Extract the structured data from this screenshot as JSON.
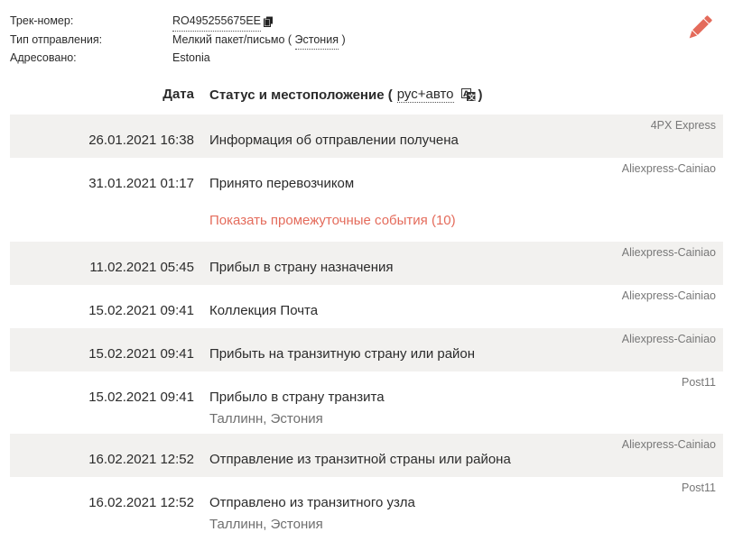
{
  "info": {
    "track_label": "Трек-номер:",
    "track_value": "RO495255675EE",
    "type_label": "Тип отправления:",
    "type_value_prefix": "Мелкий пакет/письмо ( ",
    "type_country": "Эстония",
    "type_value_suffix": " )",
    "address_label": "Адресовано:",
    "address_value": "Estonia"
  },
  "icons": {
    "copy": "copy-icon",
    "edit": "pencil-icon",
    "translate": "translate-icon"
  },
  "colors": {
    "accent": "#e46b5b",
    "row_shade": "#f2f1ef"
  },
  "table": {
    "date_header": "Дата",
    "status_header_prefix": "Статус и местоположение (",
    "status_lang": "рус+авто",
    "status_header_suffix": ")"
  },
  "events_top": [
    {
      "date": "26.01.2021 16:38",
      "status": "Информация об отправлении получена",
      "carrier": "4PX Express"
    },
    {
      "date": "31.01.2021 01:17",
      "status": "Принято перевозчиком",
      "carrier": "Aliexpress-Cainiao"
    }
  ],
  "show_more": "Показать промежуточные события (10)",
  "events": [
    {
      "date": "11.02.2021 05:45",
      "status": "Прибыл в страну назначения",
      "carrier": "Aliexpress-Cainiao",
      "location": ""
    },
    {
      "date": "15.02.2021 09:41",
      "status": "Коллекция Почта",
      "carrier": "Aliexpress-Cainiao",
      "location": ""
    },
    {
      "date": "15.02.2021 09:41",
      "status": "Прибыть на транзитную страну или район",
      "carrier": "Aliexpress-Cainiao",
      "location": ""
    },
    {
      "date": "15.02.2021 09:41",
      "status": "Прибыло в страну транзита",
      "carrier": "Post11",
      "location": "Таллинн, Эстония"
    },
    {
      "date": "16.02.2021 12:52",
      "status": "Отправление из транзитной страны или района",
      "carrier": "Aliexpress-Cainiao",
      "location": ""
    },
    {
      "date": "16.02.2021 12:52",
      "status": "Отправлено из транзитного узла",
      "carrier": "Post11",
      "location": "Таллинн, Эстония"
    }
  ]
}
